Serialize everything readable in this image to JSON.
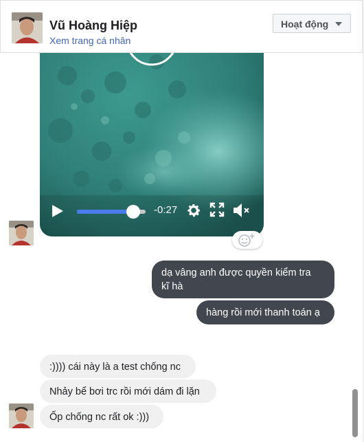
{
  "header": {
    "name": "Vũ Hoàng Hiệp",
    "profile_link": "Xem trang cá nhân",
    "status_button": "Hoạt động"
  },
  "video": {
    "time_remaining": "-0:27",
    "progress": 0.82
  },
  "messages": {
    "outgoing": [
      {
        "line1": "dạ vâng anh được quyền kiểm tra",
        "line2": "kĩ hà"
      },
      {
        "text": "hàng rồi mới thanh toán ạ"
      }
    ],
    "incoming": [
      {
        "text": ":)))) cái này là a test chống nc"
      },
      {
        "text": "Nhảy bể bơi trc rồi mới dám đi lặn"
      },
      {
        "text": "Ốp chống nc rất ok :)))"
      }
    ]
  },
  "colors": {
    "outgoing_bubble": "#42464e",
    "incoming_bubble": "#f1f0f0",
    "link": "#4267b2",
    "video_progress": "#4b7bec"
  },
  "icons": [
    "play-icon",
    "gear-icon",
    "fullscreen-icon",
    "mute-icon",
    "add-reaction-icon",
    "chevron-down-icon"
  ]
}
